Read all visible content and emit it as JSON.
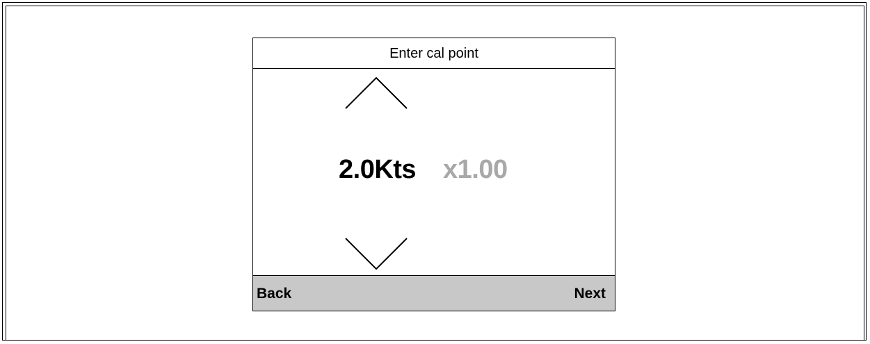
{
  "dialog": {
    "title": "Enter cal point"
  },
  "controls": {
    "up_icon": "chevron-up-icon",
    "down_icon": "chevron-down-icon"
  },
  "value": {
    "speed": "2.0Kts",
    "factor": "x1.00",
    "factor_color": "#a8a8a8"
  },
  "softkeys": {
    "back_label": "Back",
    "next_label": "Next",
    "bar_color": "#c8c8c8"
  }
}
